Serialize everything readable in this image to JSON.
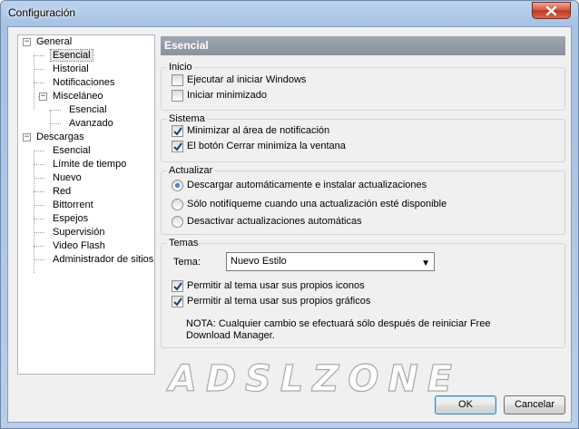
{
  "window": {
    "title": "Configuración"
  },
  "tree": {
    "items": [
      {
        "label": "General",
        "level": 0,
        "expanded": true
      },
      {
        "label": "Esencial",
        "level": 1,
        "selected": true
      },
      {
        "label": "Historial",
        "level": 1
      },
      {
        "label": "Notificaciones",
        "level": 1
      },
      {
        "label": "Misceláneo",
        "level": 1,
        "expanded": true
      },
      {
        "label": "Esencial",
        "level": 2
      },
      {
        "label": "Avanzado",
        "level": 2
      },
      {
        "label": "Descargas",
        "level": 0,
        "expanded": true
      },
      {
        "label": "Esencial",
        "level": 1
      },
      {
        "label": "Límite de tiempo",
        "level": 1
      },
      {
        "label": "Nuevo",
        "level": 1
      },
      {
        "label": "Red",
        "level": 1
      },
      {
        "label": "Bittorrent",
        "level": 1
      },
      {
        "label": "Espejos",
        "level": 1
      },
      {
        "label": "Supervisión",
        "level": 1
      },
      {
        "label": "Video Flash",
        "level": 1
      },
      {
        "label": "Administrador de sitios",
        "level": 1
      }
    ]
  },
  "panel": {
    "header": "Esencial",
    "inicio": {
      "title": "Inicio",
      "options": [
        {
          "label": "Ejecutar al iniciar Windows",
          "checked": false
        },
        {
          "label": "Iniciar minimizado",
          "checked": false
        }
      ]
    },
    "sistema": {
      "title": "Sistema",
      "options": [
        {
          "label": "Minimizar al área de notificación",
          "checked": true
        },
        {
          "label": "El botón Cerrar minimiza la ventana",
          "checked": true
        }
      ]
    },
    "actualizar": {
      "title": "Actualizar",
      "options": [
        {
          "label": "Descargar automáticamente e instalar actualizaciones",
          "selected": true
        },
        {
          "label": "Sólo notifíqueme cuando una actualización esté disponible",
          "selected": false
        },
        {
          "label": "Desactivar actualizaciones automáticas",
          "selected": false
        }
      ]
    },
    "temas": {
      "title": "Temas",
      "theme_label": "Tema:",
      "theme_value": "Nuevo Estilo",
      "options": [
        {
          "label": "Permitir al tema usar sus propios iconos",
          "checked": true
        },
        {
          "label": "Permitir al tema usar sus propios gráficos",
          "checked": true
        }
      ],
      "note": "NOTA: Cualquier cambio se efectuará sólo después de reiniciar Free Download Manager."
    }
  },
  "buttons": {
    "ok": "OK",
    "cancel": "Cancelar"
  },
  "watermark": "ADSLZONE",
  "colors": {
    "header_bg": "#949ba5",
    "check": "#1c3f7a",
    "close_button": "#c7442d"
  }
}
